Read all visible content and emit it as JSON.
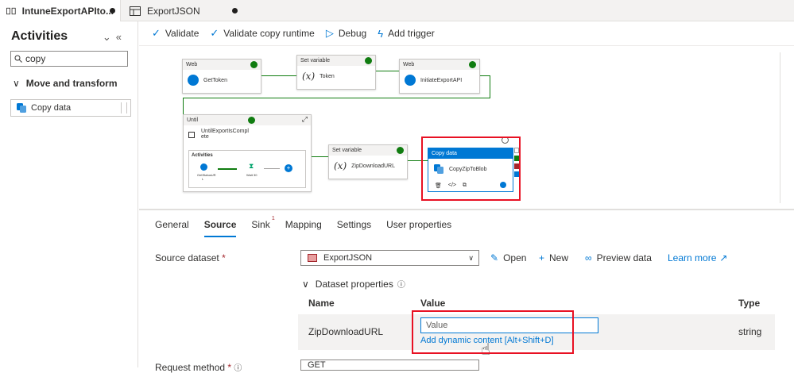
{
  "tabs": [
    {
      "label": "IntuneExportAPIto...",
      "icon": "pipeline-icon"
    },
    {
      "label": "ExportJSON",
      "icon": "dataset-table-icon"
    }
  ],
  "activities": {
    "title": "Activities",
    "search_value": "copy",
    "group": "Move and transform",
    "item": "Copy data"
  },
  "toolbar": {
    "validate": "Validate",
    "validate_copy": "Validate copy runtime",
    "debug": "Debug",
    "add_trigger": "Add trigger"
  },
  "nodes": {
    "web1_type": "Web",
    "web1_name": "GetToken",
    "setvar1_type": "Set variable",
    "setvar1_name": "Token",
    "web2_type": "Web",
    "web2_name": "InitiateExportAPI",
    "until_type": "Until",
    "until_name_1": "UntilExportIsCompl",
    "until_name_2": "ete",
    "until_inner_label": "Activities",
    "inner_get": "GetStatusUR",
    "inner_get2": "L",
    "inner_wait": "Wait 30",
    "setvar2_type": "Set variable",
    "setvar2_name": "ZipDownloadURL",
    "copy_type": "Copy data",
    "copy_name": "CopyZipToBlob"
  },
  "panel": {
    "tabs": [
      "General",
      "Source",
      "Sink",
      "Mapping",
      "Settings",
      "User properties"
    ],
    "sink_badge": "1",
    "source_dataset_label": "Source dataset",
    "required_mark": "*",
    "dataset_value": "ExportJSON",
    "open": "Open",
    "new": "New",
    "preview": "Preview data",
    "learn_more": "Learn more",
    "dataset_props": "Dataset properties",
    "col_name": "Name",
    "col_value": "Value",
    "col_type": "Type",
    "row_name": "ZipDownloadURL",
    "row_value_placeholder": "Value",
    "row_type": "string",
    "dynamic_content": "Add dynamic content [Alt+Shift+D]",
    "request_method_label": "Request method",
    "request_method_value": "GET"
  },
  "colors": {
    "accent": "#0078d4",
    "success": "#107c10",
    "highlight": "#e81123"
  }
}
